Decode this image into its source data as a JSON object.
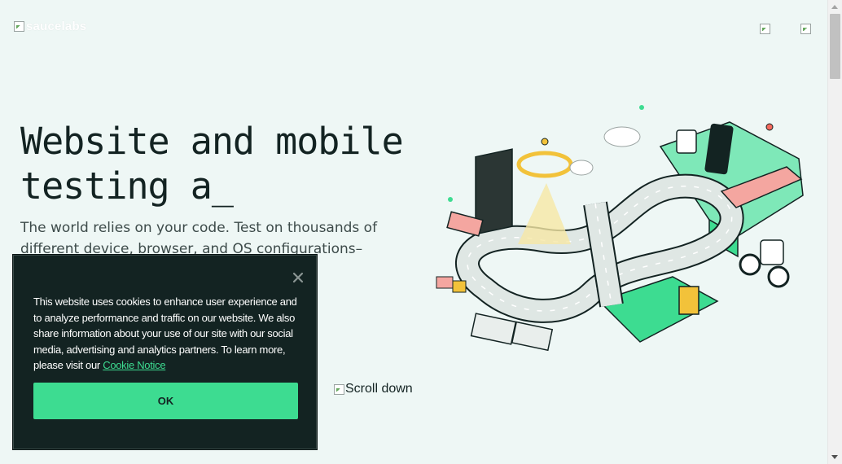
{
  "header": {
    "logo_alt": "saucelabs"
  },
  "hero": {
    "title_line1": "Website and mobile",
    "title_line2": "testing a_",
    "subtitle": "The world relies on your code. Test on thousands of different device, browser, and OS configurations–"
  },
  "scroll_down": {
    "label": "Scroll down"
  },
  "cookie_banner": {
    "text": "This website uses cookies to enhance user experience and to analyze performance and traffic on our website. We also share information about your use of our site with our social media, advertising and analytics partners. To learn more, please visit our",
    "link_label": "Cookie Notice",
    "ok_label": "OK",
    "close_icon": "close-icon"
  },
  "colors": {
    "background": "#eef7f5",
    "text": "#132322",
    "accent_green": "#3ddc91",
    "banner_bg": "#132322"
  }
}
